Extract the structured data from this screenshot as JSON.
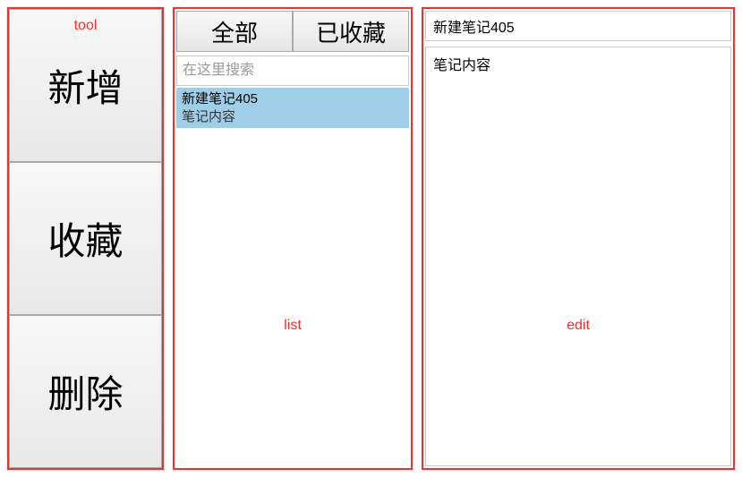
{
  "annotations": {
    "tool_label": "tool",
    "list_label": "list",
    "edit_label": "edit"
  },
  "tool": {
    "add_label": "新增",
    "favorite_label": "收藏",
    "delete_label": "删除"
  },
  "list": {
    "tabs": {
      "all_label": "全部",
      "favorited_label": "已收藏"
    },
    "search_placeholder": "在这里搜索",
    "items": [
      {
        "title": "新建笔记405",
        "preview": "笔记内容",
        "selected": true
      }
    ]
  },
  "edit": {
    "title_value": "新建笔记405",
    "body_value": "笔记内容"
  }
}
